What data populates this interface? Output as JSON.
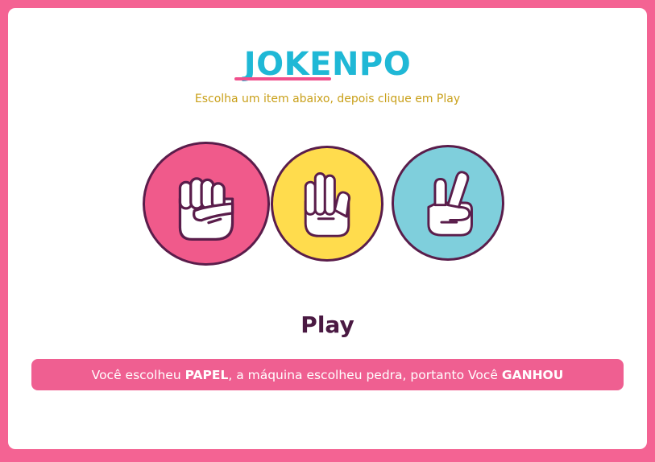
{
  "header": {
    "title": "JOKENPO",
    "subtitle": "Escolha um item abaixo, depois clique em Play"
  },
  "choices": [
    {
      "name": "pedra",
      "icon": "fist-icon",
      "color": "#f05a8b"
    },
    {
      "name": "papel",
      "icon": "open-hand-icon",
      "color": "#ffdc4d"
    },
    {
      "name": "tesoura",
      "icon": "peace-hand-icon",
      "color": "#7fcfdc"
    }
  ],
  "play_label": "Play",
  "result": {
    "part1": "Você escolheu ",
    "player_choice": "PAPEL",
    "part2": ", a máquina escolheu pedra, portanto Você ",
    "outcome": "GANHOU"
  },
  "colors": {
    "background": "#f46393",
    "title": "#1fb8d6",
    "title_underline": "#f04f8c",
    "subtitle": "#c9a01a",
    "play": "#4a1942",
    "result_background": "#ef5f91",
    "outline": "#5a1d4b"
  }
}
